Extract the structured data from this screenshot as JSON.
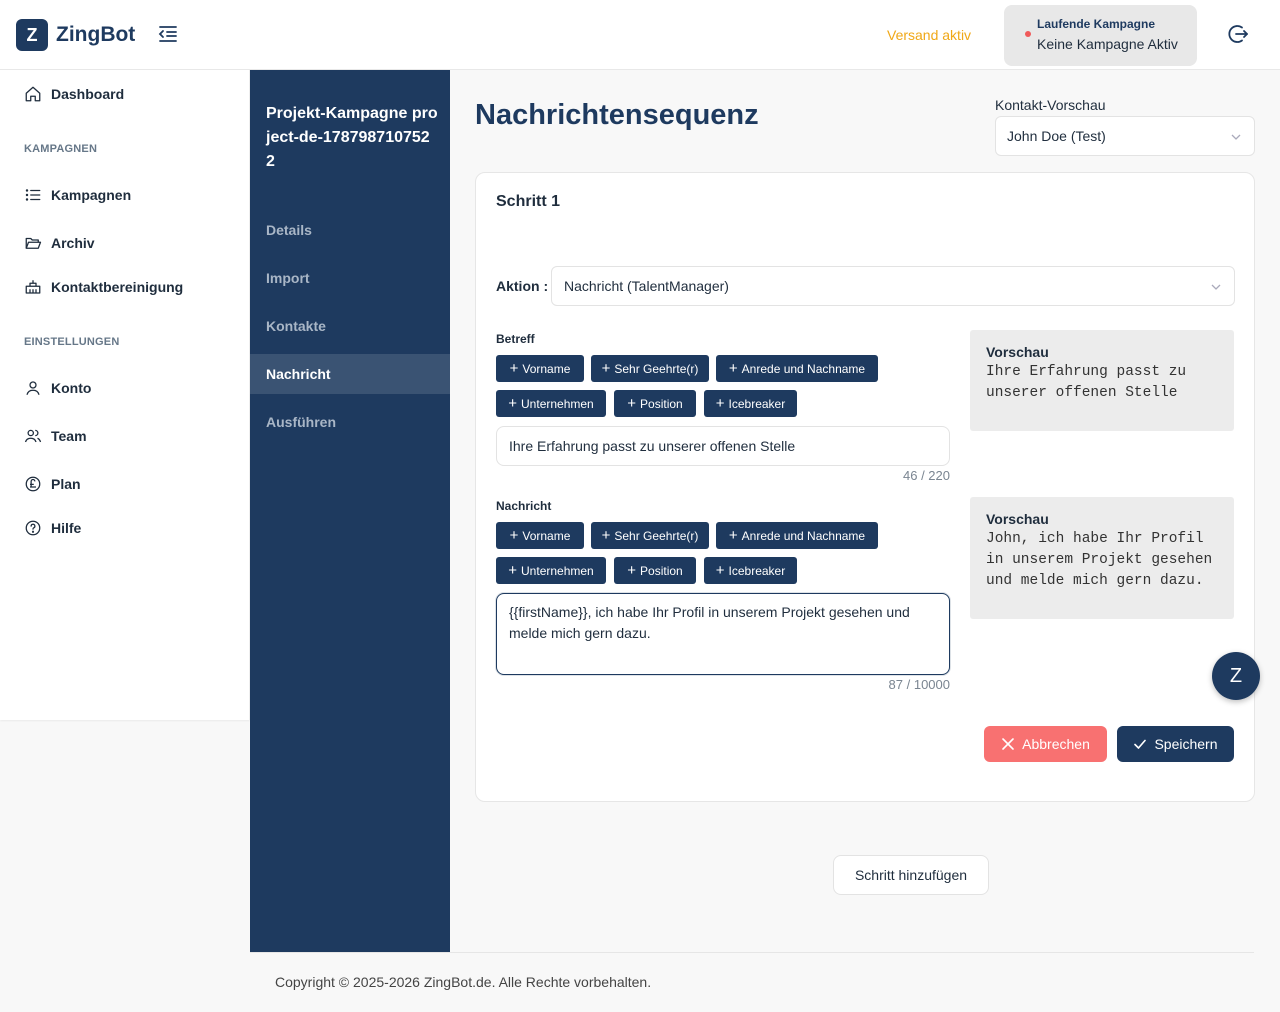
{
  "app": {
    "logo_letter": "Z",
    "name": "ZingBot"
  },
  "header": {
    "status": "Versand aktiv",
    "campaign_title": "Laufende Kampagne",
    "campaign_value": "Keine Kampagne Aktiv"
  },
  "sidebar": {
    "dashboard": "Dashboard",
    "section_campaigns": "KAMPAGNEN",
    "campaigns": "Kampagnen",
    "archive": "Archiv",
    "contact_cleanup": "Kontaktbereinigung",
    "section_settings": "EINSTELLUNGEN",
    "account": "Konto",
    "team": "Team",
    "plan": "Plan",
    "help": "Hilfe"
  },
  "project": {
    "title": "Projekt-Kampagne project-de-1787987107522",
    "items": [
      "Details",
      "Import",
      "Kontakte",
      "Nachricht",
      "Ausführen"
    ],
    "active_index": 3
  },
  "main": {
    "title": "Nachrichtensequenz",
    "preview_label": "Kontakt-Vorschau",
    "preview_contact": "John Doe (Test)"
  },
  "step": {
    "title": "Schritt 1",
    "action_label": "Aktion",
    "action_separator": ":",
    "action_value": "Nachricht (TalentManager)",
    "tags": [
      "Vorname",
      "Sehr Geehrte(r)",
      "Anrede und Nachname",
      "Unternehmen",
      "Position",
      "Icebreaker"
    ],
    "subject": {
      "label": "Betreff",
      "value": "Ihre Erfahrung passt zu unserer offenen Stelle",
      "counter": "46 / 220",
      "preview_title": "Vorschau",
      "preview_text": "Ihre Erfahrung passt zu unserer offenen Stelle"
    },
    "message": {
      "label": "Nachricht",
      "value": "{{firstName}}, ich habe Ihr Profil in unserem Projekt gesehen und melde mich gern dazu.",
      "counter": "87 / 10000",
      "preview_title": "Vorschau",
      "preview_text": "John, ich habe Ihr Profil in unserem Projekt gesehen und melde mich gern dazu."
    },
    "cancel": "Abbrechen",
    "save": "Speichern"
  },
  "add_step": "Schritt hinzufügen",
  "chat_letter": "Z",
  "footer": "Copyright © 2025-2026 ZingBot.de. Alle Rechte vorbehalten.",
  "colors": {
    "primary": "#1e3a5f",
    "accent_warning": "#f0a818",
    "danger": "#f87171",
    "status_dot": "#f05a5a"
  }
}
